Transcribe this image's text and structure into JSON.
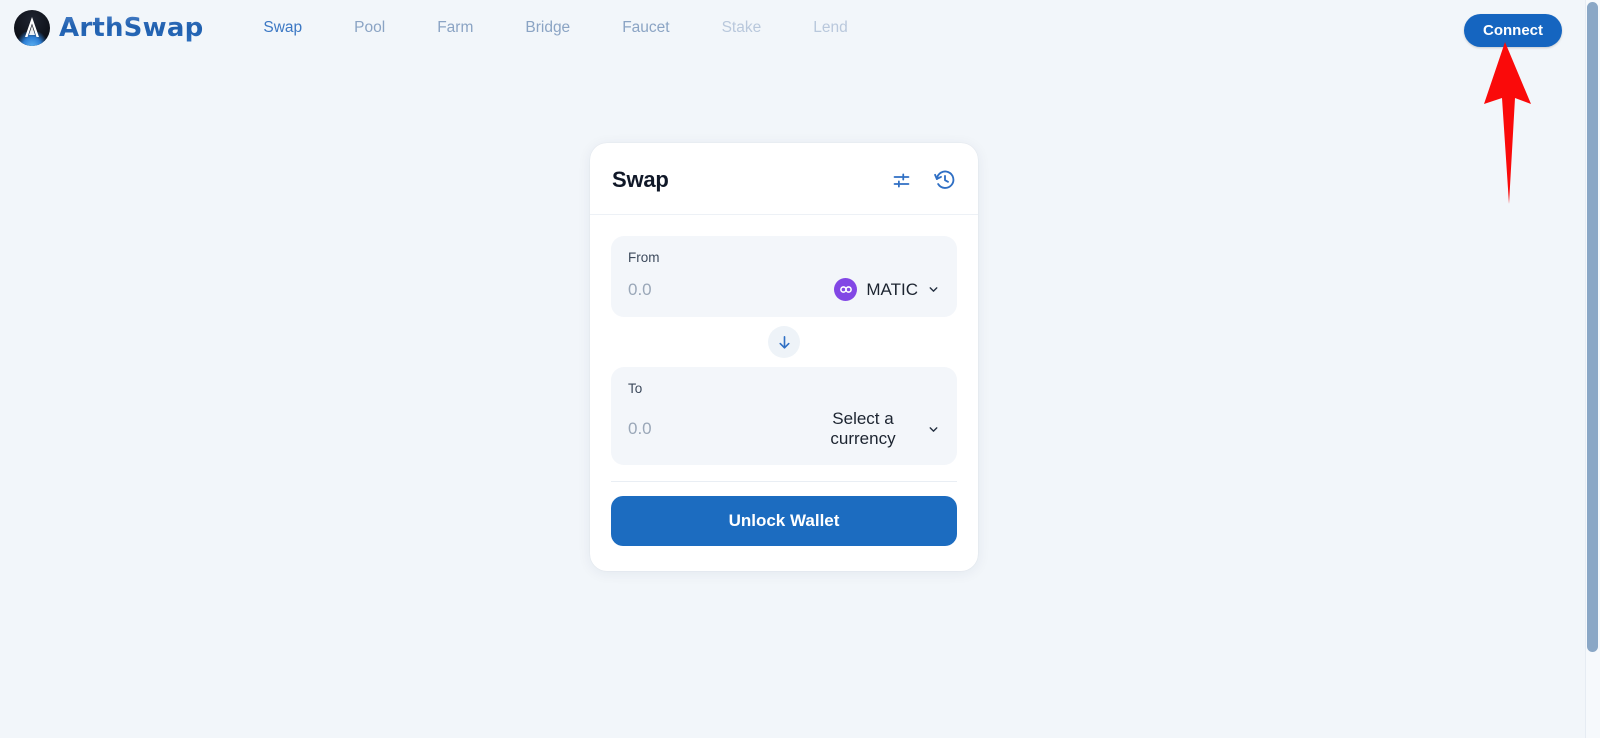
{
  "brand": {
    "name": "ArthSwap",
    "logo_icon": "arthswap-logo-icon"
  },
  "nav": {
    "items": [
      {
        "label": "Swap",
        "state": "active"
      },
      {
        "label": "Pool",
        "state": "normal"
      },
      {
        "label": "Farm",
        "state": "normal"
      },
      {
        "label": "Bridge",
        "state": "normal"
      },
      {
        "label": "Faucet",
        "state": "normal"
      },
      {
        "label": "Stake",
        "state": "muted"
      },
      {
        "label": "Lend",
        "state": "muted"
      }
    ]
  },
  "header": {
    "connect_label": "Connect"
  },
  "swap_card": {
    "title": "Swap",
    "settings_icon": "sliders-settings-icon",
    "history_icon": "history-clock-icon",
    "from": {
      "label": "From",
      "amount_value": "",
      "amount_placeholder": "0.0",
      "currency": "MATIC",
      "currency_icon": "matic-token-icon",
      "chevron_icon": "chevron-down-icon"
    },
    "switch_icon": "arrow-down-icon",
    "to": {
      "label": "To",
      "amount_value": "",
      "amount_placeholder": "0.0",
      "currency": "Select a currency",
      "chevron_icon": "chevron-down-icon"
    },
    "action_label": "Unlock Wallet"
  },
  "annotation": {
    "arrow_icon": "red-up-arrow-annotation",
    "color": "#fa0a0a"
  },
  "colors": {
    "page_background": "#f2f6fa",
    "accent_blue": "#1565c0",
    "nav_active": "#3c78c4",
    "nav_normal": "#8ba4c4",
    "nav_muted": "#b9c8dc",
    "card_background": "#ffffff",
    "field_background": "#f3f6fa",
    "matic_purple": "#8247e5",
    "button_blue": "#1c6cc0"
  }
}
